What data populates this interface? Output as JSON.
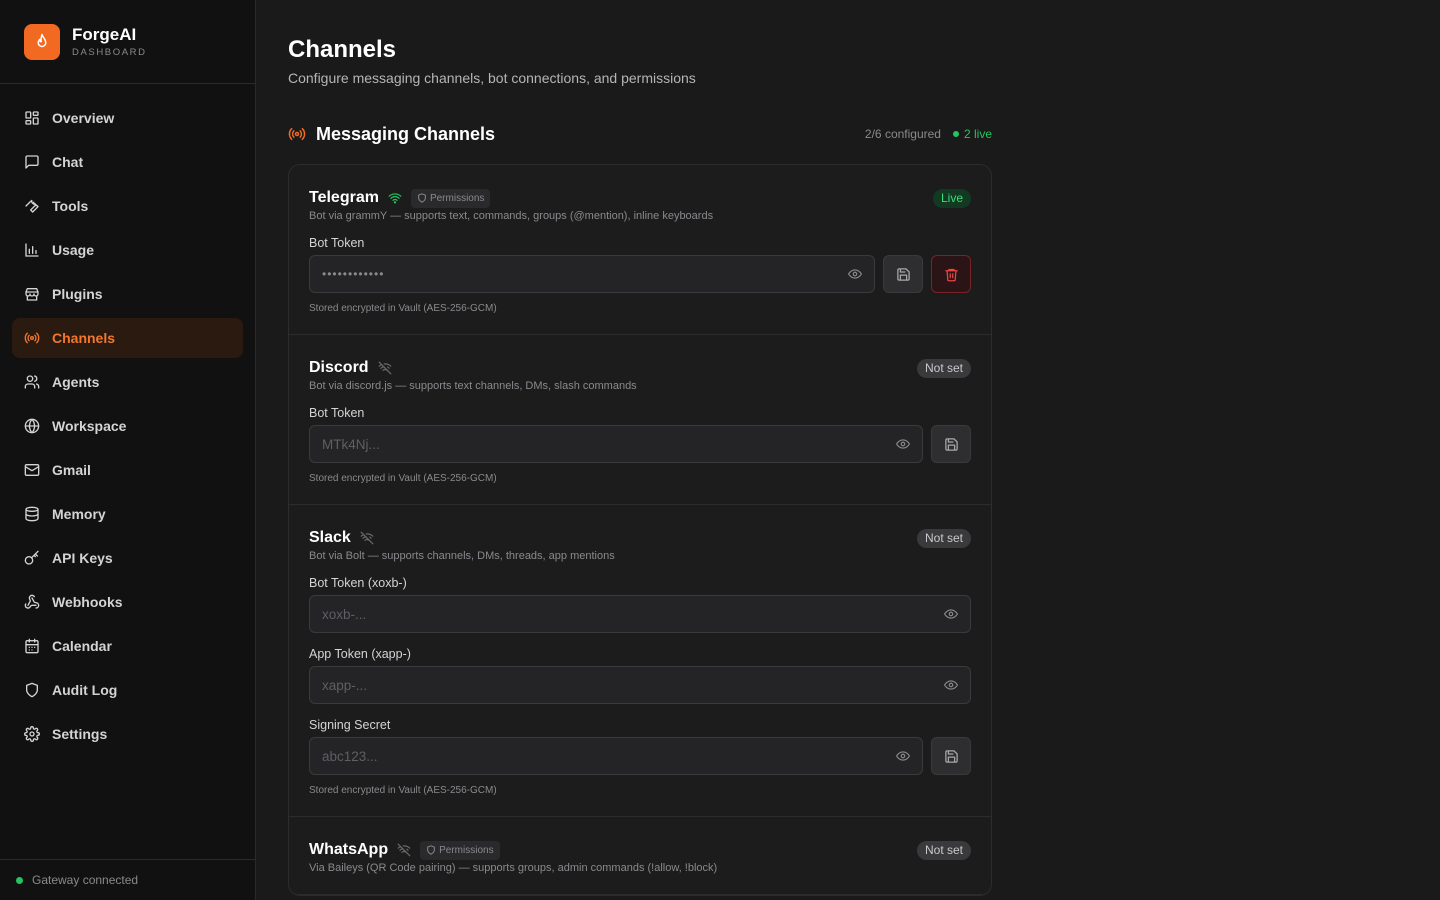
{
  "brand": {
    "name": "ForgeAI",
    "subtitle": "DASHBOARD"
  },
  "nav": [
    {
      "label": "Overview",
      "icon": "grid-icon"
    },
    {
      "label": "Chat",
      "icon": "chat-icon"
    },
    {
      "label": "Tools",
      "icon": "wrench-icon"
    },
    {
      "label": "Usage",
      "icon": "bar-chart-icon"
    },
    {
      "label": "Plugins",
      "icon": "store-icon"
    },
    {
      "label": "Channels",
      "icon": "radio-icon",
      "active": true
    },
    {
      "label": "Agents",
      "icon": "users-icon"
    },
    {
      "label": "Workspace",
      "icon": "globe-icon"
    },
    {
      "label": "Gmail",
      "icon": "mail-icon"
    },
    {
      "label": "Memory",
      "icon": "database-icon"
    },
    {
      "label": "API Keys",
      "icon": "key-icon"
    },
    {
      "label": "Webhooks",
      "icon": "webhook-icon"
    },
    {
      "label": "Calendar",
      "icon": "calendar-icon"
    },
    {
      "label": "Audit Log",
      "icon": "shield-icon"
    },
    {
      "label": "Settings",
      "icon": "gear-icon"
    }
  ],
  "footer": {
    "status": "Gateway connected"
  },
  "page": {
    "title": "Channels",
    "subtitle": "Configure messaging channels, bot connections, and permissions"
  },
  "section": {
    "title": "Messaging Channels",
    "configured": "2/6 configured",
    "live": "2 live"
  },
  "permissions_label": "Permissions",
  "channels": {
    "telegram": {
      "name": "Telegram",
      "desc": "Bot via grammY — supports text, commands, groups (@mention), inline keyboards",
      "status": "Live",
      "field_label": "Bot Token",
      "value": "••••••••••••",
      "stored": "Stored encrypted in Vault (AES-256-GCM)"
    },
    "discord": {
      "name": "Discord",
      "desc": "Bot via discord.js — supports text channels, DMs, slash commands",
      "status": "Not set",
      "field_label": "Bot Token",
      "placeholder": "MTk4Nj...",
      "stored": "Stored encrypted in Vault (AES-256-GCM)"
    },
    "slack": {
      "name": "Slack",
      "desc": "Bot via Bolt — supports channels, DMs, threads, app mentions",
      "status": "Not set",
      "bot_label": "Bot Token (xoxb-)",
      "bot_placeholder": "xoxb-...",
      "app_label": "App Token (xapp-)",
      "app_placeholder": "xapp-...",
      "secret_label": "Signing Secret",
      "secret_placeholder": "abc123...",
      "stored": "Stored encrypted in Vault (AES-256-GCM)"
    },
    "whatsapp": {
      "name": "WhatsApp",
      "desc": "Via Baileys (QR Code pairing) — supports groups, admin commands (!allow, !block)",
      "status": "Not set"
    }
  },
  "colors": {
    "accent": "#f26a21",
    "live": "#22c55e",
    "danger": "#ef4444"
  }
}
